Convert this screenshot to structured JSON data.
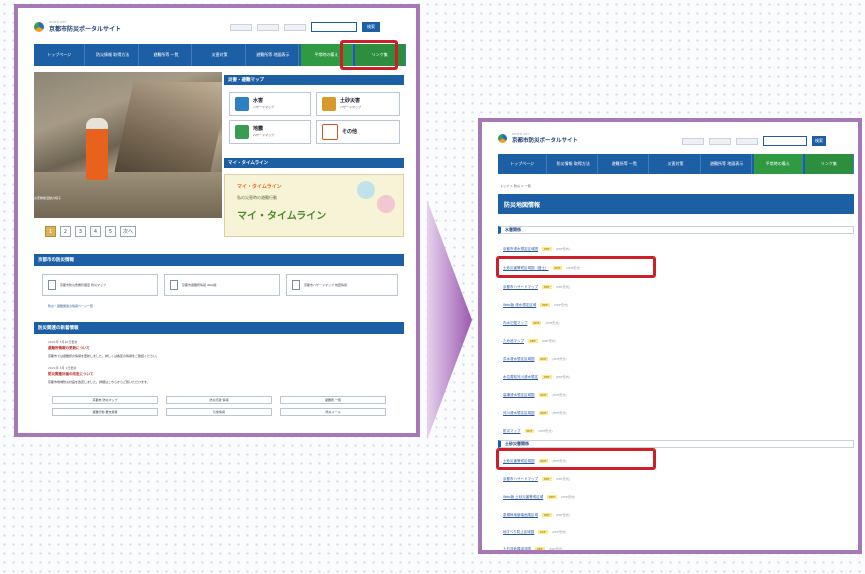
{
  "colors": {
    "primary": "#1d5fa4",
    "green": "#2f9a41",
    "highlight": "#cc1f2a",
    "frame": "#a678b6"
  },
  "header": {
    "site_title": "京都市防災ポータルサイト",
    "site_tagline": "KYOTO CITY",
    "search_button": "検索"
  },
  "nav1": [
    "トップページ",
    "防災情報 取得方法",
    "避難所等 一覧",
    "災害対策",
    "避難所等 地図表示",
    "平常時の備え",
    "リンク集"
  ],
  "nav2": [
    "トップページ",
    "防災情報 取得方法",
    "避難所等 一覧",
    "災害対策",
    "避難所等 地図表示",
    "平常時の備え",
    "リンク集"
  ],
  "hero": {
    "caption": "災害救助活動の様子"
  },
  "pager": [
    "1",
    "2",
    "3",
    "4",
    "5",
    "次へ"
  ],
  "quick": {
    "title": "災害・避難マップ",
    "buttons": [
      {
        "label": "水害",
        "sub": "ハザードマップ"
      },
      {
        "label": "土砂災害",
        "sub": "ハザードマップ"
      },
      {
        "label": "地震",
        "sub": "ハザードマップ"
      },
      {
        "label": "その他",
        "sub": ""
      }
    ]
  },
  "timeline": {
    "head": "マイ・タイムライン",
    "line1": "マイ・タイムライン",
    "line2": "私の災害時の避難行動",
    "line3": "マイ・タイムライン"
  },
  "documents": {
    "title": "京都市の防災情報",
    "cards": [
      "京都市防災危機管理室 防災マップ",
      "京都市避難所情報 Web版",
      "京都市ハザードマップ 地図情報"
    ],
    "more": "防災・避難関連の情報ページ一覧"
  },
  "news": {
    "title": "防災関連の新着情報",
    "items": [
      {
        "date": "2021年 5月20日更新",
        "title": "避難所情報の更新について",
        "body": "京都市では避難所の情報を更新しました。詳しくは各区の情報をご確認ください。"
      },
      {
        "date": "2021年 4月 1日更新",
        "title": "防災関連計画の改定について",
        "body": "京都市地域防災計画を改定しました。詳細はこちらからご覧いただけます。"
      }
    ]
  },
  "links": [
    "京都市 防災マップ",
    "防災行政 情報",
    "避難所 一覧",
    "避難行動 要支援者",
    "気象情報",
    "防災メール"
  ],
  "page2": {
    "breadcrumb": "トップ ＞ 防災 ＞ 一覧",
    "heading": "防災地図情報",
    "section1": "水害関係",
    "items1": [
      {
        "label": "京都市浸水想定区域図",
        "badge": "PDF",
        "meta": "(PDF形式)"
      },
      {
        "label": "土砂災害警戒区域図（盛土）",
        "badge": "PDF",
        "meta": "(PDF形式)"
      },
      {
        "label": "京都市ハザードマップ",
        "badge": "PDF",
        "meta": "(PDF形式)"
      },
      {
        "label": "Web版 浸水想定区域",
        "badge": "PDF",
        "meta": "(PDF形式)"
      },
      {
        "label": "内水氾濫マップ",
        "badge": "PDF",
        "meta": "(PDF形式)"
      },
      {
        "label": "ため池マップ",
        "badge": "PDF",
        "meta": "(PDF形式)"
      },
      {
        "label": "洪水浸水想定区域図",
        "badge": "PDF",
        "meta": "(PDF形式)"
      },
      {
        "label": "水位周知河川浸水想定",
        "badge": "PDF",
        "meta": "(PDF形式)"
      },
      {
        "label": "高潮浸水想定区域図",
        "badge": "PDF",
        "meta": "(PDF形式)"
      },
      {
        "label": "河川浸水想定区域図",
        "badge": "PDF",
        "meta": "(PDF形式)"
      },
      {
        "label": "防災マップ",
        "badge": "PDF",
        "meta": "(PDF形式)"
      }
    ],
    "section2": "土砂災害関係",
    "items2": [
      {
        "label": "土砂災害警戒区域図",
        "badge": "PDF",
        "meta": "(PDF形式)"
      },
      {
        "label": "京都市ハザードマップ",
        "badge": "PDF",
        "meta": "(PDF形式)"
      },
      {
        "label": "Web版 土砂災害警戒区域",
        "badge": "PDF",
        "meta": "(PDF形式)"
      },
      {
        "label": "急傾斜地崩壊危険区域",
        "badge": "PDF",
        "meta": "(PDF形式)"
      },
      {
        "label": "地すべり防止区域図",
        "badge": "PDF",
        "meta": "(PDF形式)"
      },
      {
        "label": "土石流危険渓流図",
        "badge": "PDF",
        "meta": "(PDF形式)"
      }
    ]
  }
}
